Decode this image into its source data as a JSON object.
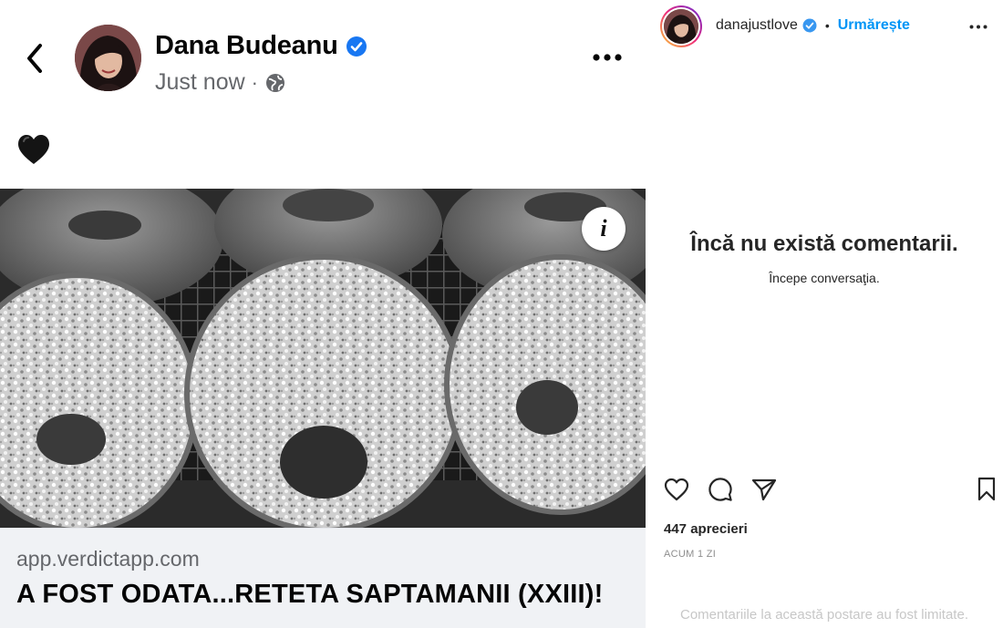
{
  "facebook_post": {
    "author": "Dana Budeanu",
    "timestamp": "Just now",
    "meta_separator": "·",
    "post_text_emoji": "black-heart",
    "link_domain": "app.verdictapp.com",
    "link_headline": "A FOST ODATA...RETETA SAPTAMANII (XXIII)!",
    "icons": {
      "back": "chevron-left-icon",
      "verified": "verified-badge-icon",
      "audience": "globe-icon",
      "more": "more-horizontal-icon",
      "info": "info-icon"
    },
    "colors": {
      "verified": "#1877f2",
      "meta_text": "#65676b",
      "link_box": "#f0f2f5"
    }
  },
  "instagram_panel": {
    "username": "danajustlove",
    "separator": "•",
    "follow_label": "Urmărește",
    "empty_title": "Încă nu există comentarii.",
    "empty_subtitle": "Începe conversaţia.",
    "likes": "447 aprecieri",
    "time_ago": "ACUM 1 ZI",
    "comments_limited": "Comentariile la această postare au fost limitate.",
    "icons": {
      "like": "heart-outline-icon",
      "comment": "comment-icon",
      "share": "send-icon",
      "save": "bookmark-icon",
      "more": "more-horizontal-icon"
    },
    "colors": {
      "follow": "#0095f6",
      "verified": "#3897f0",
      "muted": "#8e8e8e"
    }
  }
}
